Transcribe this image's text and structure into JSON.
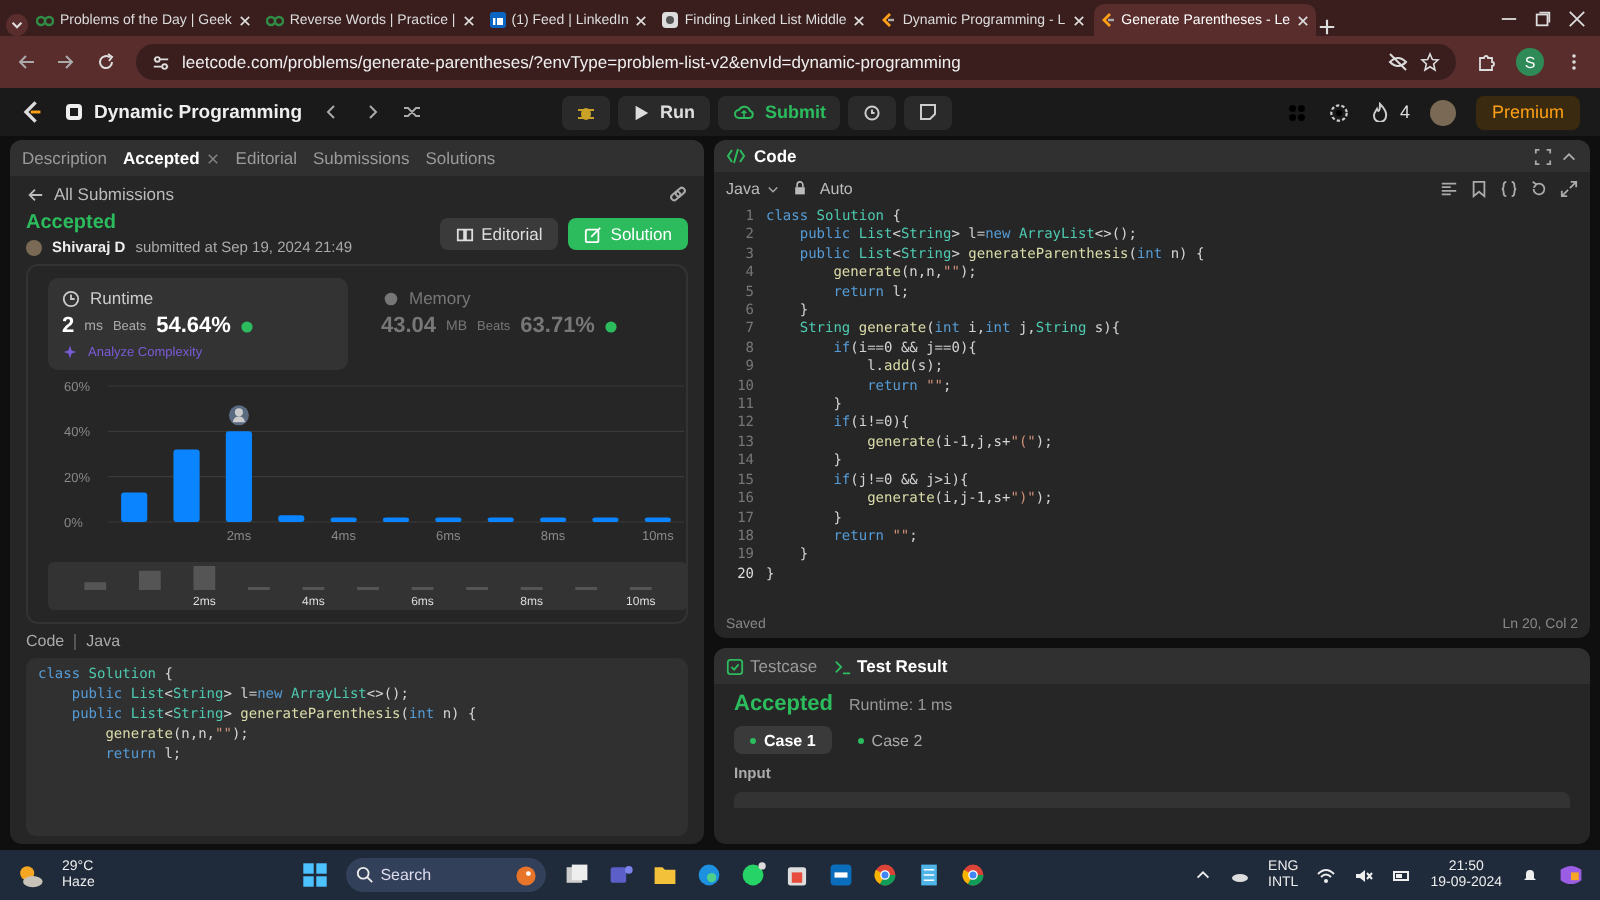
{
  "browser": {
    "tabs": [
      {
        "title": "Problems of the Day | Geek",
        "kind": "gfg",
        "selected": false
      },
      {
        "title": "Reverse Words | Practice |",
        "kind": "gfg",
        "selected": false
      },
      {
        "title": "(1) Feed | LinkedIn",
        "kind": "linkedin",
        "selected": false
      },
      {
        "title": "Finding Linked List Middle",
        "kind": "generic",
        "selected": false
      },
      {
        "title": "Dynamic Programming - L",
        "kind": "leetcode",
        "selected": false
      },
      {
        "title": "Generate Parentheses - Le",
        "kind": "leetcode",
        "selected": true
      }
    ],
    "address": "leetcode.com/problems/generate-parentheses/?envType=problem-list-v2&envId=dynamic-programming",
    "profile": "S"
  },
  "nav": {
    "title": "Dynamic Programming",
    "run": "Run",
    "submit": "Submit",
    "streak": "4",
    "premium": "Premium"
  },
  "left": {
    "tabs": [
      {
        "label": "Description",
        "selected": false,
        "closable": false
      },
      {
        "label": "Accepted",
        "selected": true,
        "closable": true
      },
      {
        "label": "Editorial",
        "selected": false,
        "closable": false
      },
      {
        "label": "Submissions",
        "selected": false,
        "closable": false
      },
      {
        "label": "Solutions",
        "selected": false,
        "closable": false
      }
    ],
    "back": "All Submissions",
    "status": "Accepted",
    "author": "Shivaraj D",
    "submitted": "submitted at Sep 19, 2024 21:49",
    "buttons": [
      {
        "label": "Editorial",
        "kind": "secondary"
      },
      {
        "label": "Solution",
        "kind": "primary"
      }
    ],
    "stats": [
      {
        "kind": "runtime",
        "title": "Runtime",
        "value": "2",
        "unit": "ms",
        "beats_label": "Beats",
        "beats": "54.64%",
        "link": "Analyze Complexity",
        "selected": true
      },
      {
        "kind": "memory",
        "title": "Memory",
        "value": "43.04",
        "unit": "MB",
        "beats_label": "Beats",
        "beats": "63.71%",
        "selected": false
      }
    ],
    "chart_data": {
      "type": "bar",
      "x": [
        0,
        1,
        2,
        3,
        4,
        5,
        6,
        7,
        8,
        9,
        10
      ],
      "values": [
        13,
        32,
        40,
        3,
        2,
        2,
        2,
        2,
        2,
        2,
        2
      ],
      "xlim": [
        -0.5,
        10.5
      ],
      "ylim": [
        0,
        60
      ],
      "yticks": [
        {
          "value": 0,
          "label": "0%"
        },
        {
          "value": 20,
          "label": "20%"
        },
        {
          "value": 40,
          "label": "40%"
        },
        {
          "value": 60,
          "label": "60%"
        }
      ],
      "xticks": [
        {
          "value": 2,
          "label": "2ms"
        },
        {
          "value": 4,
          "label": "4ms"
        },
        {
          "value": 6,
          "label": "6ms"
        },
        {
          "value": 8,
          "label": "8ms"
        },
        {
          "value": 10,
          "label": "10ms"
        }
      ]
    },
    "overview": {
      "labels": [
        "2ms",
        "4ms",
        "6ms",
        "8ms",
        "10ms"
      ]
    },
    "code_label": "Code",
    "code_lang": "Java",
    "code": [
      {
        "tokens": [
          {
            "text": "class ",
            "kind": "keyword"
          },
          {
            "text": "Solution ",
            "kind": "type"
          },
          {
            "text": "{",
            "kind": "plain"
          }
        ]
      },
      {
        "tokens": [
          {
            "text": "    public ",
            "kind": "keyword"
          },
          {
            "text": "List",
            "kind": "type"
          },
          {
            "text": "<",
            "kind": "plain"
          },
          {
            "text": "String",
            "kind": "type"
          },
          {
            "text": "> l=",
            "kind": "plain"
          },
          {
            "text": "new ",
            "kind": "keyword"
          },
          {
            "text": "ArrayList",
            "kind": "type"
          },
          {
            "text": "<>();",
            "kind": "plain"
          }
        ]
      },
      {
        "tokens": [
          {
            "text": "    public ",
            "kind": "keyword"
          },
          {
            "text": "List",
            "kind": "type"
          },
          {
            "text": "<",
            "kind": "plain"
          },
          {
            "text": "String",
            "kind": "type"
          },
          {
            "text": "> ",
            "kind": "plain"
          },
          {
            "text": "generateParenthesis",
            "kind": "function"
          },
          {
            "text": "(",
            "kind": "plain"
          },
          {
            "text": "int ",
            "kind": "keyword"
          },
          {
            "text": "n) {",
            "kind": "plain"
          }
        ]
      },
      {
        "tokens": [
          {
            "text": "        generate",
            "kind": "function"
          },
          {
            "text": "(n,n,",
            "kind": "plain"
          },
          {
            "text": "\"\"",
            "kind": "string"
          },
          {
            "text": ");",
            "kind": "plain"
          }
        ]
      },
      {
        "tokens": [
          {
            "text": "        return ",
            "kind": "keyword"
          },
          {
            "text": "l;",
            "kind": "plain"
          }
        ]
      }
    ]
  },
  "editor": {
    "title": "Code",
    "language": "Java",
    "mode": "Auto",
    "status": "Saved",
    "position": "Ln 20, Col 2",
    "lines": [
      {
        "number": "1",
        "tokens": [
          {
            "text": "class ",
            "kind": "keyword"
          },
          {
            "text": "Solution ",
            "kind": "type"
          },
          {
            "text": "{",
            "kind": "plain"
          }
        ]
      },
      {
        "number": "2",
        "tokens": [
          {
            "text": "    public ",
            "kind": "keyword"
          },
          {
            "text": "List",
            "kind": "type"
          },
          {
            "text": "<",
            "kind": "plain"
          },
          {
            "text": "String",
            "kind": "type"
          },
          {
            "text": "> l=",
            "kind": "plain"
          },
          {
            "text": "new ",
            "kind": "keyword"
          },
          {
            "text": "ArrayList",
            "kind": "type"
          },
          {
            "text": "<>();",
            "kind": "plain"
          }
        ]
      },
      {
        "number": "3",
        "tokens": [
          {
            "text": "    public ",
            "kind": "keyword"
          },
          {
            "text": "List",
            "kind": "type"
          },
          {
            "text": "<",
            "kind": "plain"
          },
          {
            "text": "String",
            "kind": "type"
          },
          {
            "text": "> ",
            "kind": "plain"
          },
          {
            "text": "generateParenthesis",
            "kind": "function"
          },
          {
            "text": "(",
            "kind": "plain"
          },
          {
            "text": "int ",
            "kind": "keyword"
          },
          {
            "text": "n) {",
            "kind": "plain"
          }
        ]
      },
      {
        "number": "4",
        "tokens": [
          {
            "text": "        generate",
            "kind": "function"
          },
          {
            "text": "(n,n,",
            "kind": "plain"
          },
          {
            "text": "\"\"",
            "kind": "string"
          },
          {
            "text": ");",
            "kind": "plain"
          }
        ]
      },
      {
        "number": "5",
        "tokens": [
          {
            "text": "        return ",
            "kind": "keyword"
          },
          {
            "text": "l;",
            "kind": "plain"
          }
        ]
      },
      {
        "number": "6",
        "tokens": [
          {
            "text": "    }",
            "kind": "plain"
          }
        ]
      },
      {
        "number": "7",
        "tokens": [
          {
            "text": "    String ",
            "kind": "type"
          },
          {
            "text": "generate",
            "kind": "function"
          },
          {
            "text": "(",
            "kind": "plain"
          },
          {
            "text": "int ",
            "kind": "keyword"
          },
          {
            "text": "i,",
            "kind": "plain"
          },
          {
            "text": "int ",
            "kind": "keyword"
          },
          {
            "text": "j,",
            "kind": "plain"
          },
          {
            "text": "String ",
            "kind": "type"
          },
          {
            "text": "s){",
            "kind": "plain"
          }
        ]
      },
      {
        "number": "8",
        "tokens": [
          {
            "text": "        if",
            "kind": "keyword"
          },
          {
            "text": "(i==0 && j==0){",
            "kind": "plain"
          }
        ]
      },
      {
        "number": "9",
        "tokens": [
          {
            "text": "            l.",
            "kind": "plain"
          },
          {
            "text": "add",
            "kind": "function"
          },
          {
            "text": "(s);",
            "kind": "plain"
          }
        ]
      },
      {
        "number": "10",
        "tokens": [
          {
            "text": "            return ",
            "kind": "keyword"
          },
          {
            "text": "\"\"",
            "kind": "string"
          },
          {
            "text": ";",
            "kind": "plain"
          }
        ]
      },
      {
        "number": "11",
        "tokens": [
          {
            "text": "        }",
            "kind": "plain"
          }
        ]
      },
      {
        "number": "12",
        "tokens": [
          {
            "text": "        if",
            "kind": "keyword"
          },
          {
            "text": "(i!=0){",
            "kind": "plain"
          }
        ]
      },
      {
        "number": "13",
        "tokens": [
          {
            "text": "            generate",
            "kind": "function"
          },
          {
            "text": "(i-1,j,s+",
            "kind": "plain"
          },
          {
            "text": "\"(\"",
            "kind": "string"
          },
          {
            "text": ");",
            "kind": "plain"
          }
        ]
      },
      {
        "number": "14",
        "tokens": [
          {
            "text": "        }",
            "kind": "plain"
          }
        ]
      },
      {
        "number": "15",
        "tokens": [
          {
            "text": "        if",
            "kind": "keyword"
          },
          {
            "text": "(j!=0 && j>i){",
            "kind": "plain"
          }
        ]
      },
      {
        "number": "16",
        "tokens": [
          {
            "text": "            generate",
            "kind": "function"
          },
          {
            "text": "(i,j-1,s+",
            "kind": "plain"
          },
          {
            "text": "\")\"",
            "kind": "string"
          },
          {
            "text": ");",
            "kind": "plain"
          }
        ]
      },
      {
        "number": "17",
        "tokens": [
          {
            "text": "        }",
            "kind": "plain"
          }
        ]
      },
      {
        "number": "18",
        "tokens": [
          {
            "text": "        return ",
            "kind": "keyword"
          },
          {
            "text": "\"\"",
            "kind": "string"
          },
          {
            "text": ";",
            "kind": "plain"
          }
        ]
      },
      {
        "number": "19",
        "tokens": [
          {
            "text": "    }",
            "kind": "plain"
          }
        ]
      },
      {
        "number": "20",
        "tokens": [
          {
            "text": "}",
            "kind": "plain"
          }
        ]
      }
    ]
  },
  "test": {
    "tabs": [
      {
        "label": "Testcase",
        "selected": false
      },
      {
        "label": "Test Result",
        "selected": true
      }
    ],
    "verdict": "Accepted",
    "runtime": "Runtime: 1 ms",
    "cases": [
      {
        "label": "Case 1",
        "selected": true,
        "passed": true
      },
      {
        "label": "Case 2",
        "selected": false,
        "passed": true
      }
    ],
    "input_label": "Input"
  },
  "taskbar": {
    "temperature": "29°C",
    "weather": "Haze",
    "search": {
      "placeholder": "Search"
    },
    "language": "ENG",
    "layout": "INTL",
    "time": "21:50",
    "date": "19-09-2024"
  }
}
